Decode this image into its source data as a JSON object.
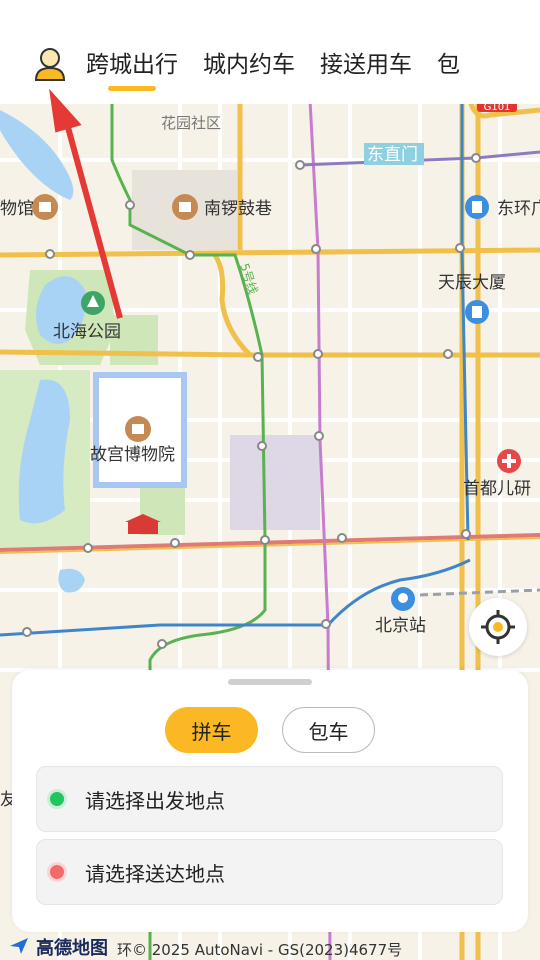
{
  "tabs": [
    {
      "label": "跨城出行",
      "active": true
    },
    {
      "label": "城内约车",
      "active": false
    },
    {
      "label": "接送用车",
      "active": false
    },
    {
      "label": "包",
      "active": false
    }
  ],
  "map": {
    "pois": [
      {
        "id": "huayuan",
        "label": "花园社区"
      },
      {
        "id": "dongzhimen",
        "label": "东直门"
      },
      {
        "id": "bowuguan-left",
        "label": "物馆"
      },
      {
        "id": "nanluoguxiang",
        "label": "南锣鼓巷"
      },
      {
        "id": "donghuan",
        "label": "东环广"
      },
      {
        "id": "tianchen",
        "label": "天辰大厦"
      },
      {
        "id": "beihai",
        "label": "北海公园"
      },
      {
        "id": "gugong",
        "label": "故宫博物院"
      },
      {
        "id": "shoudu",
        "label": "首都儿研"
      },
      {
        "id": "beijingzhan",
        "label": "北京站"
      },
      {
        "id": "line5",
        "label": "5号线"
      },
      {
        "id": "g101",
        "label": "G101"
      },
      {
        "id": "left-edge",
        "label": "友"
      }
    ]
  },
  "panel": {
    "carpool_label": "拼车",
    "charter_label": "包车",
    "start_placeholder": "请选择出发地点",
    "end_placeholder": "请选择送达地点"
  },
  "footer": {
    "logo": "高德地图",
    "copyright": "环© 2025 AutoNavi - GS(2023)4677号"
  },
  "colors": {
    "accent": "#fbb822",
    "start_dot": "#22c55e",
    "end_dot": "#f26b6b",
    "annotation_arrow": "#e53935"
  }
}
